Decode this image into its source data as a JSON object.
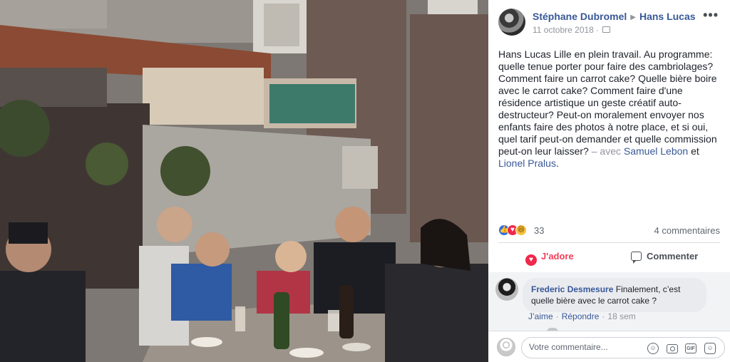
{
  "photo": {
    "description_icon": "photo",
    "colors": {
      "wall": "#8d8a86",
      "bricks": "#4a3f3b",
      "sky": "#b6aea6"
    }
  },
  "post": {
    "author": "Stéphane Dubromel",
    "target": "Hans Lucas",
    "date": "11 octobre 2018",
    "dot": "·",
    "more_label": "•••",
    "text_main": "Hans Lucas Lille en plein travail. Au programme: quelle tenue porter pour faire des cambriolages? Comment faire un carrot cake? Quelle bière boire avec le carrot cake? Comment faire d'une résidence artistique un geste créatif auto-destructeur? Peut-on moralement envoyer nos enfants faire des photos à notre place, et si oui, quel tarif peut-on demander et quelle commission peut-on leur laisser?",
    "text_with": " – avec ",
    "tag1": "Samuel Lebon",
    "text_and": " et ",
    "tag2": "Lionel Pralus",
    "text_end": "."
  },
  "reactions": {
    "like_icon": "👍",
    "love_icon": "♥",
    "haha_icon": "😆",
    "count": "33",
    "comments": "4 commentaires"
  },
  "actions": {
    "love": "J'adore",
    "comment": "Commenter",
    "heart_icon": "♥"
  },
  "comment": {
    "name": "Frederic Desmesure",
    "text": " Finalement, c’est quelle bière avec le carrot cake ?",
    "like": "J’aime",
    "dot": "·",
    "reply": "Répondre",
    "time": "18 sem"
  },
  "composer": {
    "placeholder": "Votre commentaire...",
    "emoji_icon": "☺",
    "gif_label": "GIF",
    "sticker_icon": "☺"
  },
  "colors": {
    "link": "#385898",
    "love": "#f33e58",
    "muted": "#90949c"
  }
}
